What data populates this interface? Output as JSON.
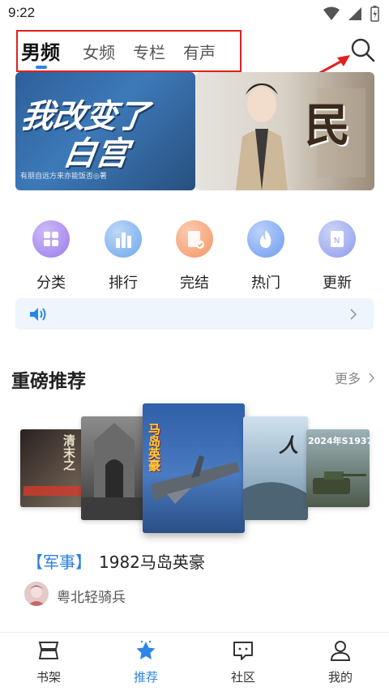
{
  "status_bar": {
    "time": "9:22"
  },
  "tabs": [
    {
      "label": "男频",
      "active": true
    },
    {
      "label": "女频",
      "active": false
    },
    {
      "label": "专栏",
      "active": false
    },
    {
      "label": "有声",
      "active": false
    }
  ],
  "banners": [
    {
      "title_line1": "我改变了",
      "title_line2": "白宫",
      "subtitle": "有朋自远方来亦能饭否◎著"
    },
    {
      "title": "民"
    }
  ],
  "shortcuts": [
    {
      "label": "分类",
      "icon": "grid-icon",
      "color": "#a98ef0"
    },
    {
      "label": "排行",
      "icon": "bar-chart-icon",
      "color": "#7eb1ef"
    },
    {
      "label": "完结",
      "icon": "book-check-icon",
      "color": "#f5a77a"
    },
    {
      "label": "热门",
      "icon": "flame-icon",
      "color": "#7aa6f0"
    },
    {
      "label": "更新",
      "icon": "notebook-icon",
      "color": "#9aa8ee"
    }
  ],
  "section": {
    "title": "重磅推荐",
    "more_label": "更多"
  },
  "covers": [
    {
      "text": "清末之",
      "badge": ""
    },
    {
      "text": "",
      "badge": ""
    },
    {
      "text": "马岛英豪",
      "badge": ""
    },
    {
      "text": "人",
      "badge": ""
    },
    {
      "text": "2024年S1937",
      "badge": ""
    }
  ],
  "featured_book": {
    "tag": "【军事】",
    "title": "1982马岛英豪",
    "author": "粤北轻骑兵"
  },
  "bottom_nav": [
    {
      "label": "书架",
      "active": false
    },
    {
      "label": "推荐",
      "active": true
    },
    {
      "label": "社区",
      "active": false
    },
    {
      "label": "我的",
      "active": false
    }
  ],
  "colors": {
    "accent": "#2b86e6",
    "annotation": "#e02020"
  }
}
